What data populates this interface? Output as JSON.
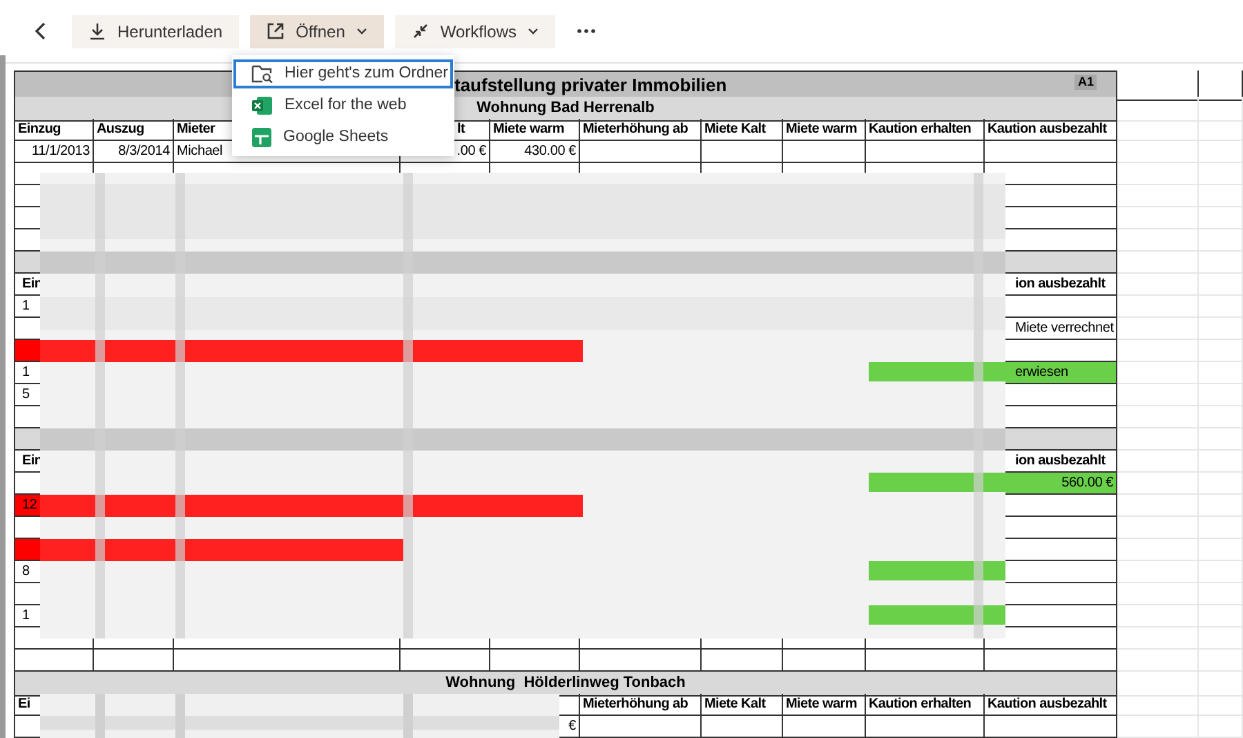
{
  "toolbar": {
    "buttons": [
      {
        "label": "Herunterladen",
        "kind": "download",
        "dropdown": false,
        "expanded": false
      },
      {
        "label": "Öffnen",
        "kind": "open",
        "dropdown": true,
        "expanded": true
      },
      {
        "label": "Workflows",
        "kind": "workflow",
        "dropdown": true,
        "expanded": false
      }
    ]
  },
  "open_menu": {
    "items": [
      {
        "label": "Hier geht's zum Ordner",
        "kind": "folder",
        "selected": true
      },
      {
        "label": "Excel for the web",
        "kind": "excel",
        "selected": false
      },
      {
        "label": "Google Sheets",
        "kind": "sheets",
        "selected": false
      }
    ]
  },
  "sheet": {
    "cell_ref": "A1",
    "rows": [
      {
        "kind": "title",
        "text": "taufstellung privater Immobilien"
      },
      {
        "kind": "section",
        "text": "Wohnung Bad Herrenalb"
      },
      {
        "kind": "header",
        "column_1": "Einzug",
        "column_2": "Auszug",
        "column_3": "Mieter",
        "column_4": "lt",
        "column_5": "Miete warm",
        "column_6": "Mieterhöhung ab",
        "column_7": "Miete Kalt",
        "column_8": "Miete warm",
        "column_9": "Kaution erhalten",
        "column_10": "Kaution ausbezahlt"
      },
      {
        "kind": "data",
        "column_1": "11/1/2013",
        "column_2": "8/3/2014",
        "column_3": "Michael",
        "column_4": ".00 €",
        "column_5": "430.00 €"
      },
      {
        "kind": "partial"
      },
      {
        "kind": "partial"
      },
      {
        "kind": "partial"
      },
      {
        "kind": "partial"
      },
      {
        "kind": "band"
      },
      {
        "kind": "partial_header",
        "column_1": "Ein",
        "column_10": "ion ausbezahlt"
      },
      {
        "kind": "partial",
        "column_1": "1"
      },
      {
        "kind": "partial",
        "column_10": "Miete verrechnet"
      },
      {
        "kind": "partial",
        "column_1": {
          "color": "#ff0000"
        }
      },
      {
        "kind": "partial",
        "column_1": "1",
        "column_10": {
          "text": "erwiesen",
          "color": "#6ad04a"
        }
      },
      {
        "kind": "partial",
        "column_1": "5"
      },
      {
        "kind": "partial"
      },
      {
        "kind": "band"
      },
      {
        "kind": "partial_header",
        "column_1": "Ein",
        "column_10": "ion ausbezahlt"
      },
      {
        "kind": "partial",
        "column_10": {
          "text": "560.00 €",
          "color": "#6ad04a",
          "kind": "amount"
        }
      },
      {
        "kind": "partial",
        "column_1": {
          "text": "12",
          "color": "#ff0000"
        }
      },
      {
        "kind": "partial"
      },
      {
        "kind": "partial",
        "column_1": {
          "color": "#ff0000"
        }
      },
      {
        "kind": "partial",
        "column_1": "8"
      },
      {
        "kind": "partial"
      },
      {
        "kind": "partial",
        "column_1": "1"
      },
      {
        "kind": "partial"
      },
      {
        "kind": "partial"
      },
      {
        "kind": "section",
        "text": "Wohnung  Hölderlinweg Tonbach"
      },
      {
        "kind": "header",
        "column_1": "Ei",
        "column_6": "Mieterhöhung ab",
        "column_7": "Miete Kalt",
        "column_8": "Miete warm",
        "column_9": "Kaution erhalten",
        "column_10": "Kaution ausbezahlt"
      },
      {
        "kind": "data",
        "column_5": "€"
      }
    ]
  }
}
